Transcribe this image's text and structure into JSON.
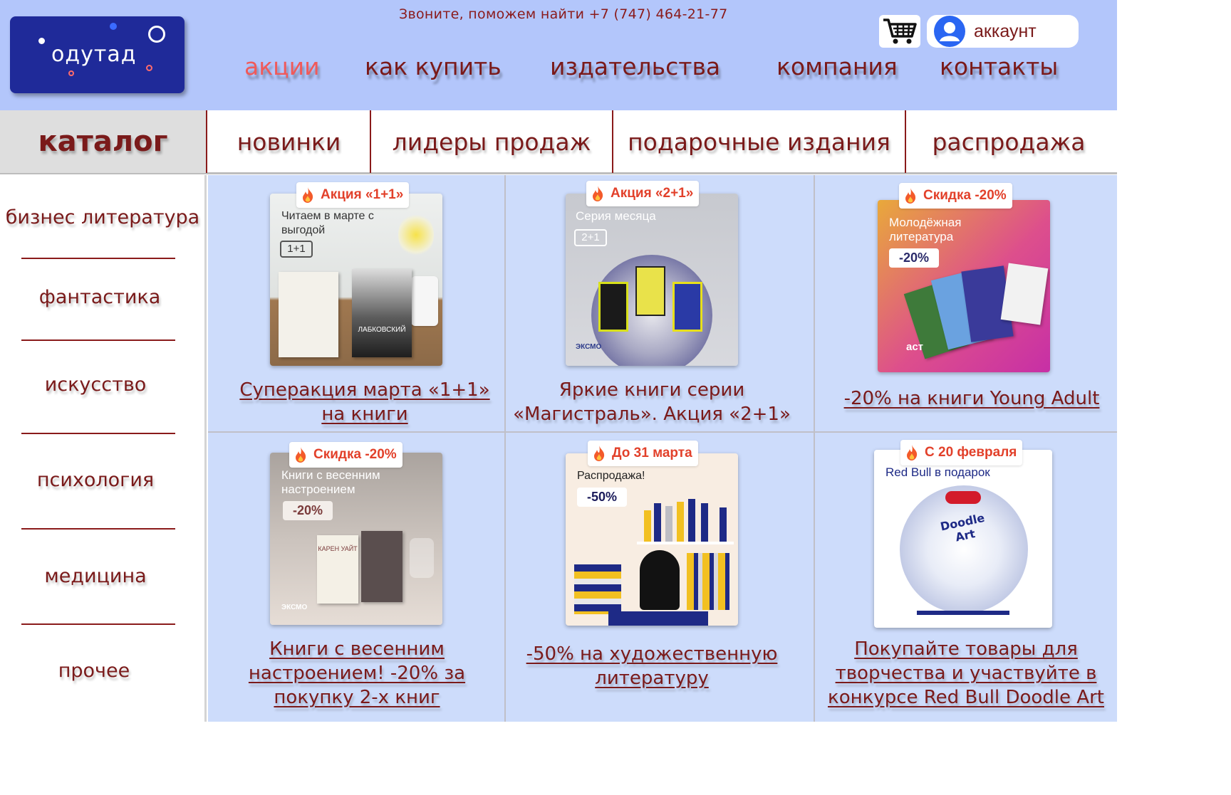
{
  "header": {
    "logo_text": "одутад",
    "phone_text": "Звоните, поможем найти +7 (747) 464-21-77",
    "account_label": "аккаунт",
    "nav": [
      {
        "label": "акции",
        "active": true
      },
      {
        "label": "как купить"
      },
      {
        "label": "издательства"
      },
      {
        "label": "компания"
      },
      {
        "label": "контакты"
      }
    ]
  },
  "tabs": {
    "catalog": "каталог",
    "items": [
      "новинки",
      "лидеры продаж",
      "подарочные издания",
      "распродажа"
    ]
  },
  "sidebar": {
    "items": [
      "бизнес литература",
      "фантастика",
      "искусство",
      "психология",
      "медицина",
      "прочее"
    ]
  },
  "promos": [
    {
      "badge": "Акция «1+1»",
      "image_heading": "Читаем в марте с выгодой",
      "image_tag": "1+1",
      "image_author": "ЛАБКОВСКИЙ",
      "title_line1": "Суперакция марта «1+1»",
      "title_line2": "на книги"
    },
    {
      "badge": "Акция «2+1»",
      "image_heading": "Серия месяца",
      "image_tag": "2+1",
      "image_brand": "ЭКСМО",
      "title_line1": "Яркие книги серии",
      "title_line2": "«Магистраль». Акция «2+1»"
    },
    {
      "badge": "Скидка -20%",
      "image_heading": "Молодёжная литература",
      "image_tag": "-20%",
      "image_brand": "аст",
      "title_line1": "-20% на книги Young Adult",
      "title_line2": ""
    },
    {
      "badge": "Скидка -20%",
      "image_heading": "Книги с весенним настроением",
      "image_tag": "-20%",
      "image_author": "КАРЕН УАЙТ",
      "image_brand": "ЭКСМО",
      "title_line1": "Книги с весенним",
      "title_line2": "настроением! -20% за",
      "title_line3": "покупку 2-х книг"
    },
    {
      "badge": "До 31 марта",
      "image_heading": "Распродажа!",
      "image_tag": "-50%",
      "title_line1": "-50% на художественную",
      "title_line2": "литературу"
    },
    {
      "badge": "С 20 февраля",
      "image_heading": "Red Bull в подарок",
      "image_art": "Doodle Art",
      "title_line1": "Покупайте товары для",
      "title_line2": "творчества и участвуйте в",
      "title_line3": "конкурсе Red Bull Doodle Art"
    }
  ],
  "colors": {
    "header_bg": "#b3c6fb",
    "grid_bg": "#cddcfb",
    "logo_bg": "#1f2a99",
    "text_maroon": "#7a1a1a",
    "active_nav": "#f05a5a",
    "badge_red": "#e2402a"
  }
}
